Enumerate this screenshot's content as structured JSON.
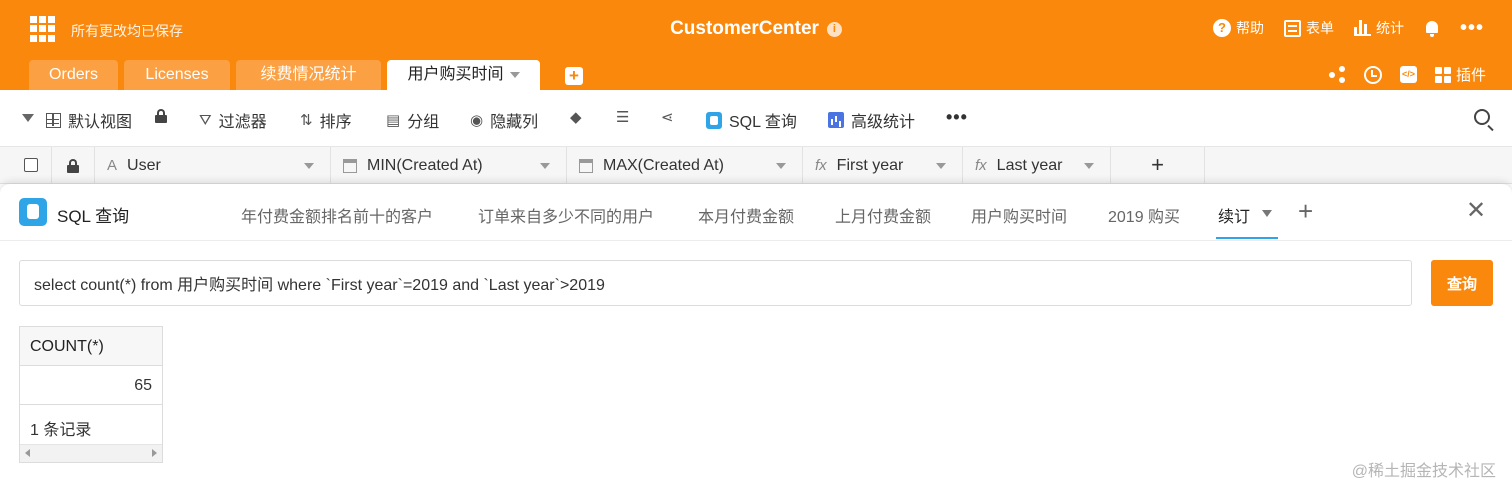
{
  "header": {
    "saved_status": "所有更改均已保存",
    "app_title": "CustomerCenter",
    "info_glyph": "i",
    "help_label": "帮助",
    "form_label": "表单",
    "stats_label": "统计",
    "more_glyph": "•••",
    "help_glyph": "?"
  },
  "tabs": [
    {
      "label": "Orders"
    },
    {
      "label": "Licenses"
    },
    {
      "label": "续费情况统计"
    },
    {
      "label": "用户购买时间"
    }
  ],
  "tabs_right": {
    "add_glyph": "+",
    "plugins_label": "插件",
    "code_glyph": "</>"
  },
  "toolbar": {
    "view_label": "默认视图",
    "filter_label": "过滤器",
    "sort_label": "排序",
    "group_label": "分组",
    "hide_columns_label": "隐藏列",
    "sql_label": "SQL 查询",
    "advanced_stats_label": "高级统计",
    "more_glyph": "•••"
  },
  "columns": [
    {
      "label": "User",
      "type_icon": "text-type-icon",
      "type_glyph": "A"
    },
    {
      "label": "MIN(Created At)",
      "type_icon": "calendar-icon"
    },
    {
      "label": "MAX(Created At)",
      "type_icon": "calendar-icon"
    },
    {
      "label": "First year",
      "type_icon": "formula-icon",
      "type_glyph": "fx"
    },
    {
      "label": "Last year",
      "type_icon": "formula-icon",
      "type_glyph": "fx"
    }
  ],
  "add_column_glyph": "+",
  "sql_panel": {
    "title": "SQL 查询",
    "query_tabs": [
      {
        "label": "年付费金额排名前十的客户"
      },
      {
        "label": "订单来自多少不同的用户"
      },
      {
        "label": "本月付费金额"
      },
      {
        "label": "上月付费金额"
      },
      {
        "label": "用户购买时间"
      },
      {
        "label": "2019 购买"
      },
      {
        "label": "续订"
      }
    ],
    "add_glyph": "+",
    "close_glyph": "✕",
    "query": "select count(*) from 用户购买时间 where `First year`=2019 and `Last year`>2019",
    "run_label": "查询",
    "result": {
      "column": "COUNT(*)",
      "value": "65",
      "record_count": "1 条记录"
    }
  },
  "watermark": "@稀土掘金技术社区",
  "colors": {
    "brand_orange": "#f9880c",
    "accent_blue": "#2fa4e7"
  }
}
